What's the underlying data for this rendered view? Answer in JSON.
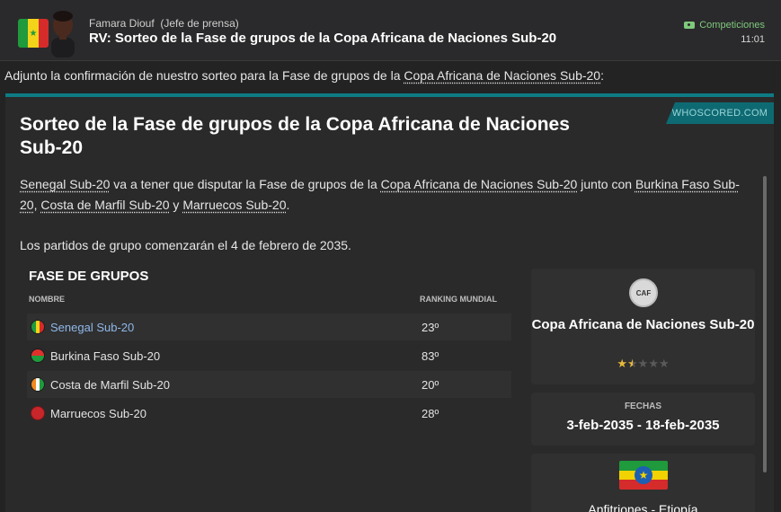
{
  "header": {
    "sender_name": "Famara Diouf",
    "sender_role": "(Jefe de prensa)",
    "subject": "RV: Sorteo de la Fase de grupos de la Copa Africana de Naciones Sub-20",
    "category": "Competiciones",
    "time": "11:01"
  },
  "intro": {
    "prefix": "Adjunto la confirmación de nuestro sorteo para la Fase de grupos de la ",
    "link": "Copa Africana de Naciones Sub-20",
    "suffix": ":"
  },
  "card": {
    "brand": "WHOSCORED.COM",
    "title": "Sorteo de la Fase de grupos de la Copa Africana de Naciones Sub-20",
    "para1": {
      "team1": "Senegal Sub-20",
      "t1": " va a tener que disputar la Fase de grupos de la ",
      "competition": "Copa Africana de Naciones Sub-20",
      "t2": " junto con ",
      "team2": "Burkina Faso Sub-20",
      "t3": ", ",
      "team3": "Costa de Marfil Sub-20",
      "t4": " y ",
      "team4": "Marruecos Sub-20",
      "t5": "."
    },
    "para2": "Los partidos de grupo comenzarán el 4 de febrero de 2035."
  },
  "groups": {
    "title": "FASE DE GRUPOS",
    "col_name": "NOMBRE",
    "col_rank": "RANKING MUNDIAL",
    "rows": [
      {
        "team": "Senegal Sub-20",
        "rank": "23º"
      },
      {
        "team": "Burkina Faso Sub-20",
        "rank": "83º"
      },
      {
        "team": "Costa de Marfil Sub-20",
        "rank": "20º"
      },
      {
        "team": "Marruecos Sub-20",
        "rank": "28º"
      }
    ]
  },
  "competition_panel": {
    "logo_text": "CAF",
    "name": "Copa Africana de Naciones Sub-20",
    "rating": 1.5,
    "rating_max": 5
  },
  "dates_panel": {
    "label": "FECHAS",
    "value": "3-feb-2035 - 18-feb-2035"
  },
  "host_panel": {
    "label": "Anfitriones - Etiopía"
  },
  "colors": {
    "accent_teal": "#0e7b84",
    "link_blue": "#8fb8e8",
    "category_green": "#7fc97c",
    "star_gold": "#e8b93a"
  }
}
